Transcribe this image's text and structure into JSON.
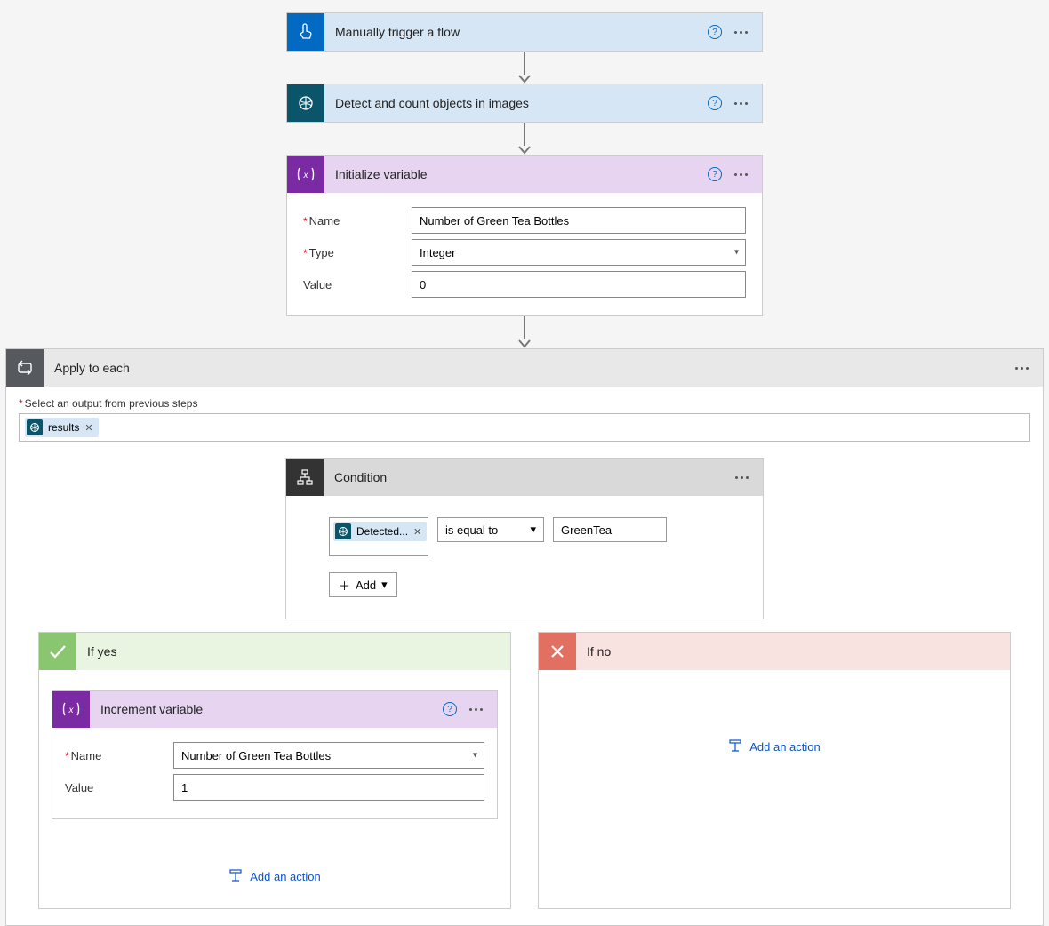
{
  "steps": {
    "trigger": {
      "title": "Manually trigger a flow"
    },
    "detect": {
      "title": "Detect and count objects in images"
    },
    "initvar": {
      "title": "Initialize variable",
      "labels": {
        "name": "Name",
        "type": "Type",
        "value": "Value"
      },
      "fields": {
        "name": "Number of Green Tea Bottles",
        "type": "Integer",
        "value": "0"
      }
    },
    "apply": {
      "title": "Apply to each",
      "select_label": "Select an output from previous steps",
      "token": "results"
    },
    "condition": {
      "title": "Condition",
      "left_token": "Detected...",
      "op": "is equal to",
      "right_value": "GreenTea",
      "add_label": "Add"
    },
    "if_yes": {
      "title": "If yes"
    },
    "if_no": {
      "title": "If no"
    },
    "increment": {
      "title": "Increment variable",
      "labels": {
        "name": "Name",
        "value": "Value"
      },
      "fields": {
        "name": "Number of Green Tea Bottles",
        "value": "1"
      }
    }
  },
  "common": {
    "add_action": "Add an action"
  }
}
